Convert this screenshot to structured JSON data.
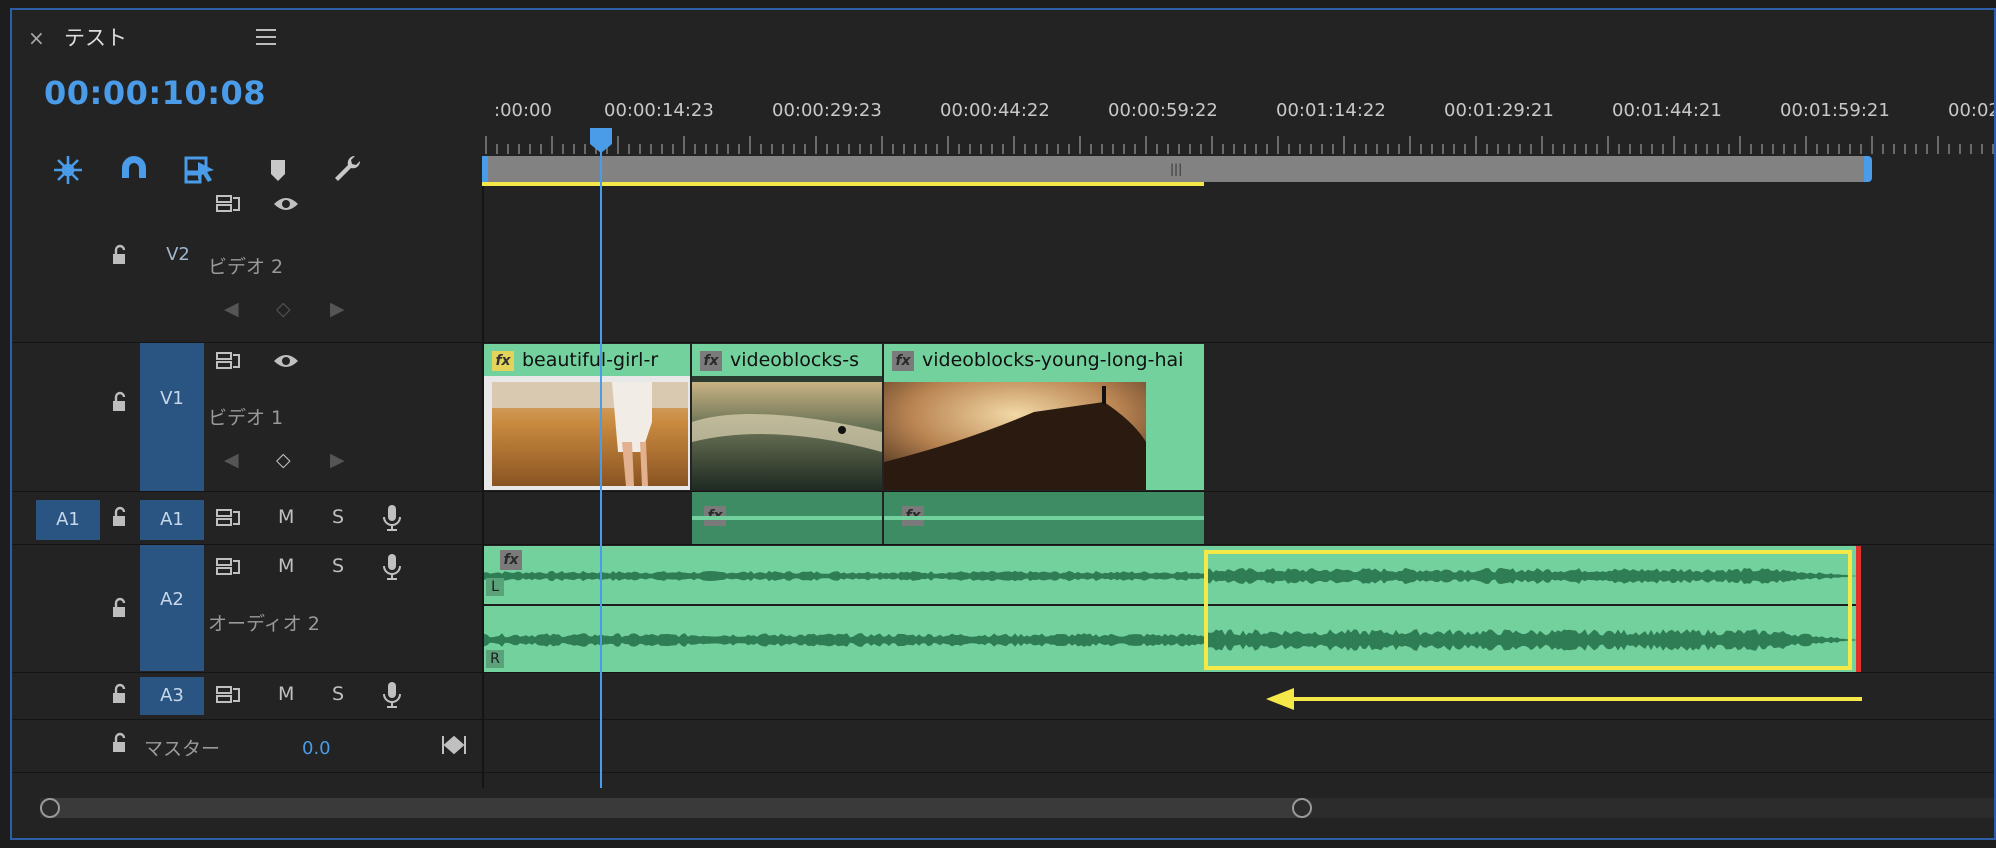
{
  "panel": {
    "sequence_title": "テスト",
    "timecode": "00:00:10:08"
  },
  "ruler": {
    "ticks": [
      ":00:00",
      "00:00:14:23",
      "00:00:29:23",
      "00:00:44:22",
      "00:00:59:22",
      "00:01:14:22",
      "00:01:29:21",
      "00:01:44:21",
      "00:01:59:21",
      "00:02"
    ]
  },
  "tracks": {
    "v2": {
      "id": "V2",
      "name": "ビデオ 2"
    },
    "v1": {
      "id": "V1",
      "name": "ビデオ 1"
    },
    "a1": {
      "source": "A1",
      "id": "A1",
      "mute": "M",
      "solo": "S"
    },
    "a2": {
      "id": "A2",
      "name": "オーディオ 2",
      "mute": "M",
      "solo": "S",
      "channel_l": "L",
      "channel_r": "R"
    },
    "a3": {
      "id": "A3",
      "mute": "M",
      "solo": "S"
    },
    "master": {
      "name": "マスター",
      "value": "0.0"
    }
  },
  "clips": {
    "c1": "beautiful-girl-r",
    "c2": "videoblocks-s",
    "c3": "videoblocks-young-long-hai",
    "fx": "fx"
  },
  "colors": {
    "accent": "#4a9be8",
    "clip_green": "#72d19d",
    "highlight_yellow": "#f5e94a",
    "track_blue": "#2a5481",
    "audio_end": "#e0322a"
  }
}
